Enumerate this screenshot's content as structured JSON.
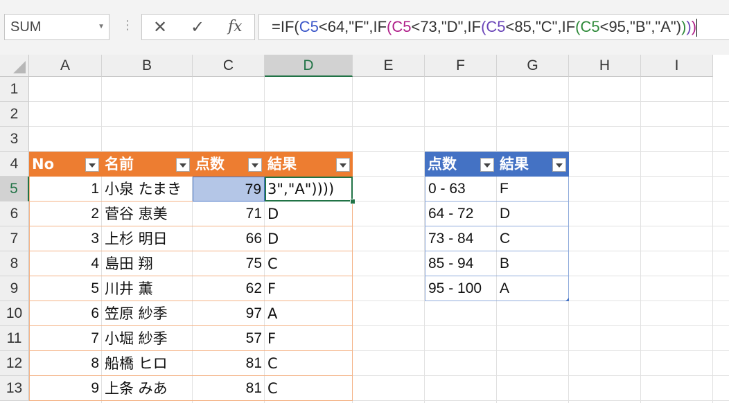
{
  "formula_bar": {
    "name_box": "SUM",
    "cancel_icon": "✕",
    "enter_icon": "✓",
    "fx_label": "fx",
    "formula_parts": [
      {
        "t": "=IF(",
        "c": ""
      },
      {
        "t": "C5",
        "c": "r1"
      },
      {
        "t": "<64,\"F\",IF",
        "c": ""
      },
      {
        "t": "(",
        "c": "p1"
      },
      {
        "t": "C5",
        "c": "r2"
      },
      {
        "t": "<73,\"D\",IF",
        "c": ""
      },
      {
        "t": "(",
        "c": "p2"
      },
      {
        "t": "C5",
        "c": "r3"
      },
      {
        "t": "<85,\"C\",IF",
        "c": ""
      },
      {
        "t": "(",
        "c": "p3"
      },
      {
        "t": "C5",
        "c": "r4"
      },
      {
        "t": "<95,\"B\",\"A\")",
        "c": ""
      },
      {
        "t": ")",
        "c": "p3"
      },
      {
        "t": ")",
        "c": "p2"
      },
      {
        "t": ")",
        "c": "p1"
      }
    ]
  },
  "columns": [
    "A",
    "B",
    "C",
    "D",
    "E",
    "F",
    "G",
    "H",
    "I"
  ],
  "selected_column": "D",
  "rows": [
    "1",
    "2",
    "3",
    "4",
    "5",
    "6",
    "7",
    "8",
    "9",
    "10",
    "11",
    "12",
    "13"
  ],
  "selected_row": "5",
  "table1": {
    "headers": [
      "No",
      "名前",
      "点数",
      "結果"
    ],
    "rows": [
      [
        "1",
        "小泉 たまき",
        "79",
        "3\",\"A\"))))"
      ],
      [
        "2",
        "菅谷 恵美",
        "71",
        "D"
      ],
      [
        "3",
        "上杉 明日",
        "66",
        "D"
      ],
      [
        "4",
        "島田 翔",
        "75",
        "C"
      ],
      [
        "5",
        "川井 薫",
        "62",
        "F"
      ],
      [
        "6",
        "笠原 紗季",
        "97",
        "A"
      ],
      [
        "7",
        "小堀 紗季",
        "57",
        "F"
      ],
      [
        "8",
        "船橋 ヒロ",
        "81",
        "C"
      ],
      [
        "9",
        "上条 みあ",
        "81",
        "C"
      ]
    ],
    "header_color": "#ED7D31"
  },
  "table2": {
    "headers": [
      "点数",
      "結果"
    ],
    "rows": [
      [
        "0 - 63",
        "F"
      ],
      [
        "64 - 72",
        "D"
      ],
      [
        "73 - 84",
        "C"
      ],
      [
        "85 - 94",
        "B"
      ],
      [
        "95 - 100",
        "A"
      ]
    ],
    "header_color": "#4472C4"
  },
  "accent_color": "#217346"
}
